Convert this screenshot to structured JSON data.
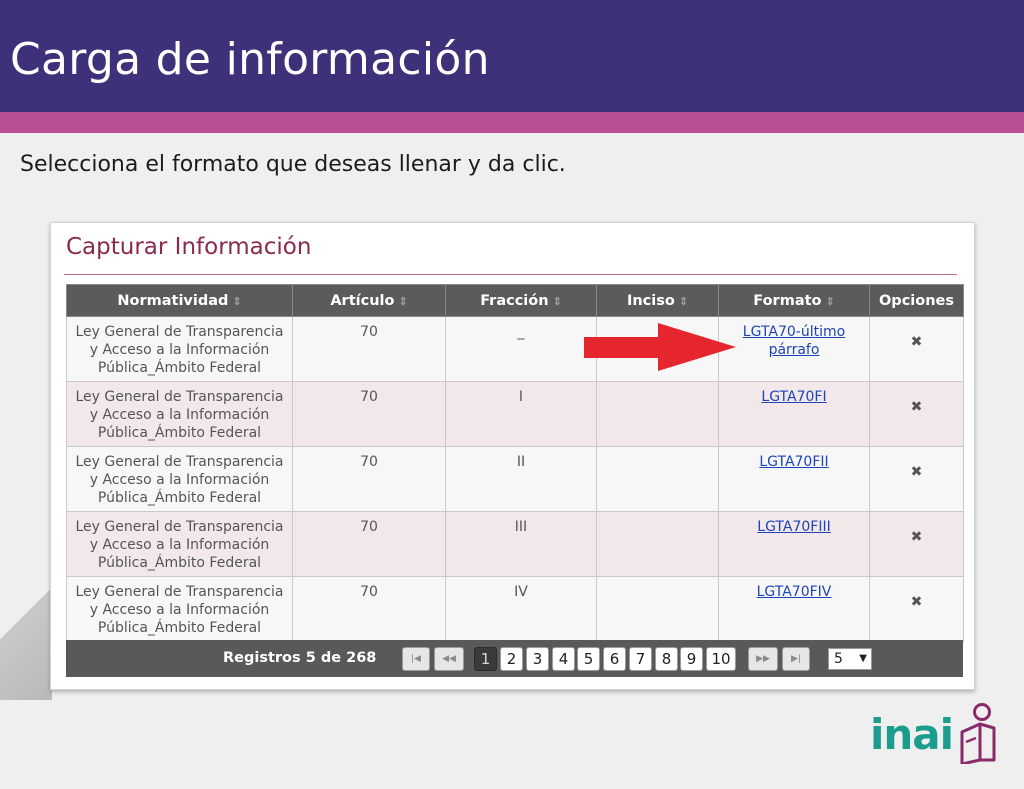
{
  "header": {
    "title": "Carga de información"
  },
  "instruction": "Selecciona el formato que deseas llenar y da clic.",
  "panel": {
    "title": "Capturar Información",
    "columns": [
      "Normatividad",
      "Artículo",
      "Fracción",
      "Inciso",
      "Formato",
      "Opciones"
    ],
    "rows": [
      {
        "normatividad": [
          "Ley General de Transparencia",
          "y Acceso a la Información",
          "Pública_Ámbito Federal"
        ],
        "articulo": "70",
        "fraccion": "_",
        "inciso": "",
        "formato": [
          "LGTA70-último",
          "párrafo"
        ],
        "opcion": "✖"
      },
      {
        "normatividad": [
          "Ley General de Transparencia",
          "y Acceso a la Información",
          "Pública_Ámbito Federal"
        ],
        "articulo": "70",
        "fraccion": "I",
        "inciso": "",
        "formato": [
          "LGTA70FI"
        ],
        "opcion": "✖"
      },
      {
        "normatividad": [
          "Ley General de Transparencia",
          "y Acceso a la Información",
          "Pública_Ámbito Federal"
        ],
        "articulo": "70",
        "fraccion": "II",
        "inciso": "",
        "formato": [
          "LGTA70FII"
        ],
        "opcion": "✖"
      },
      {
        "normatividad": [
          "Ley General de Transparencia",
          "y Acceso a la Información",
          "Pública_Ámbito Federal"
        ],
        "articulo": "70",
        "fraccion": "III",
        "inciso": "",
        "formato": [
          "LGTA70FIII"
        ],
        "opcion": "✖"
      },
      {
        "normatividad": [
          "Ley General de Transparencia",
          "y Acceso a la Información",
          "Pública_Ámbito Federal"
        ],
        "articulo": "70",
        "fraccion": "IV",
        "inciso": "",
        "formato": [
          "LGTA70FIV"
        ],
        "opcion": "✖"
      }
    ],
    "sort_icon": "⇕",
    "pagination": {
      "summary": "Registros 5 de 268",
      "first_icon": "first-page-icon",
      "prev_icon": "prev-page-icon",
      "next_icon": "next-page-icon",
      "last_icon": "last-page-icon",
      "pages": [
        "1",
        "2",
        "3",
        "4",
        "5",
        "6",
        "7",
        "8",
        "9",
        "10"
      ],
      "current_page": "1",
      "page_size": "5",
      "page_size_arrow": "▼"
    }
  },
  "annotation": {
    "arrow_color": "#e5262e"
  },
  "logo": {
    "text": "inai"
  },
  "colors": {
    "header": "#3e3079",
    "stripe": "#b84f92",
    "panel_title": "#8a2a4d",
    "link": "#1d44b8",
    "logo": "#1b9d8e"
  }
}
